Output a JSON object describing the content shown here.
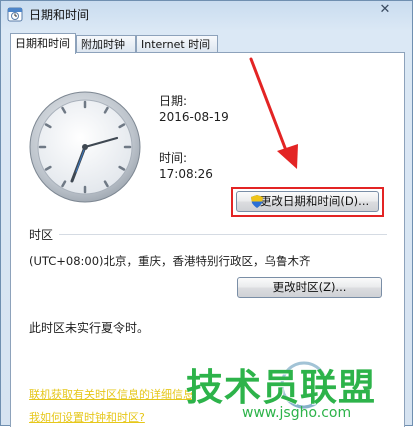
{
  "window": {
    "title": "日期和时间",
    "close_symbol": "✕"
  },
  "tabs": [
    {
      "label": "日期和时间",
      "active": true
    },
    {
      "label": "附加时钟",
      "active": false
    },
    {
      "label": "Internet 时间",
      "active": false
    }
  ],
  "date_section": {
    "date_label": "日期:",
    "date_value": "2016-08-19",
    "time_label": "时间:",
    "time_value": "17:08:26",
    "change_button": "更改日期和时间(D)..."
  },
  "timezone_section": {
    "heading": "时区",
    "value": "(UTC+08:00)北京，重庆，香港特别行政区，乌鲁木齐",
    "change_button": "更改时区(Z)...",
    "dst_note": "此时区未实行夏令时。"
  },
  "links": {
    "online_info": "联机获取有关时区信息的详细信息",
    "how_to": "我如何设置时钟和时区?"
  },
  "watermark": {
    "main_text": "技术员联盟",
    "url": "www.jsgho.com",
    "colors": {
      "primary": "#2db34a",
      "secondary": "#7aa9c4"
    }
  },
  "colors": {
    "highlight_border": "#e32424",
    "annotation_arrow": "#e32424",
    "link_text": "#e6c71a"
  }
}
